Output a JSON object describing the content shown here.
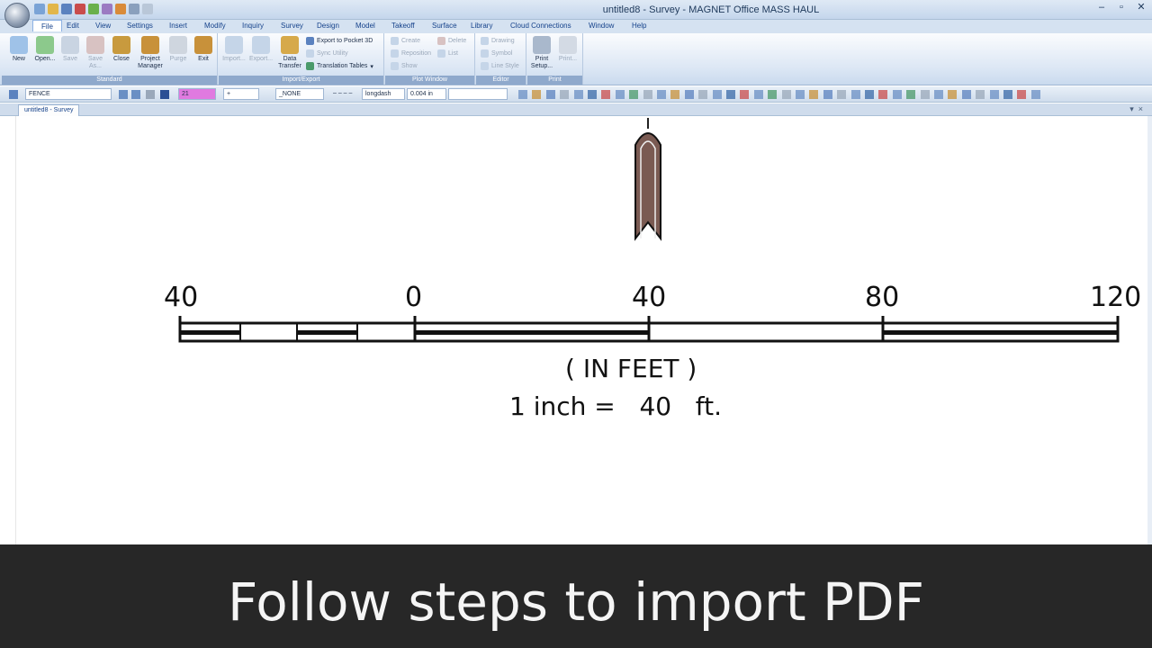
{
  "window": {
    "title": "untitled8 - Survey - MAGNET Office MASS HAUL",
    "minimize": "–",
    "maximize": "▫",
    "close": "✕"
  },
  "menu": [
    "File",
    "Edit",
    "View",
    "Settings",
    "Insert",
    "Modify",
    "Inquiry",
    "Survey",
    "Design",
    "Model",
    "Takeoff",
    "Surface",
    "Library",
    "Cloud Connections",
    "Window",
    "Help"
  ],
  "ribbon": {
    "standard": {
      "label": "Standard",
      "buttons": [
        "New",
        "Open...",
        "Save",
        "Save As...",
        "Close",
        "Project Manager",
        "Purge",
        "Exit"
      ]
    },
    "import_export": {
      "label": "Import/Export",
      "buttons": [
        "Import...",
        "Export...",
        "Data Transfer"
      ],
      "small": [
        "Export to Pocket 3D",
        "Sync Utility",
        "Translation Tables"
      ]
    },
    "plot_window": {
      "label": "Plot Window",
      "small": [
        "Create",
        "Delete",
        "Reposition",
        "List",
        "Show"
      ]
    },
    "editor": {
      "label": "Editor",
      "small": [
        "Drawing",
        "Symbol",
        "Line Style"
      ]
    },
    "print": {
      "label": "Print",
      "buttons": [
        "Print Setup...",
        "Print..."
      ]
    }
  },
  "toolbar": {
    "layer": "FENCE",
    "color_value": "21",
    "point_symbol": "+",
    "none_value": "_NONE",
    "linetype": "longdash",
    "linetype_sample": "– – – –",
    "lineweight": "0.004 in"
  },
  "document_tab": "untitled8 - Survey",
  "drawing": {
    "scale_labels": [
      "40",
      "0",
      "40",
      "80",
      "120"
    ],
    "units_text": "( IN FEET )",
    "scale_text": "1 inch =   40   ft."
  },
  "caption": "Follow steps to import PDF",
  "colors": {
    "accent": "#15428b",
    "ribbon_label": "#8fa9cc",
    "caption_bg": "#272727",
    "north_arrow": "#7a5a52"
  }
}
